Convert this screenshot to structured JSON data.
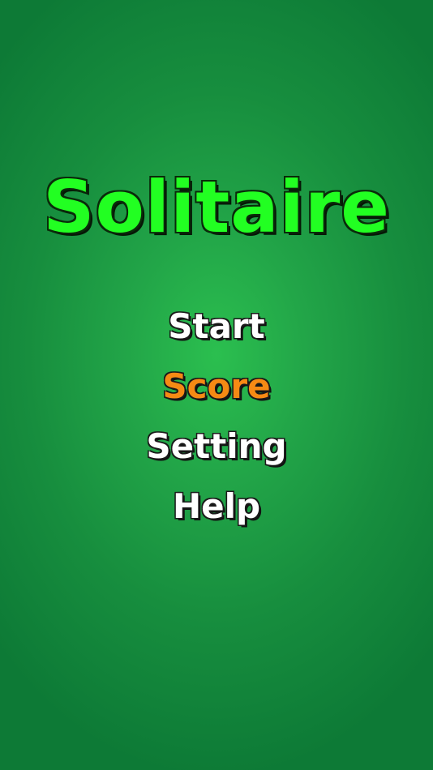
{
  "app": {
    "title": "Solitaire"
  },
  "menu": {
    "items": [
      {
        "label": "Start",
        "highlighted": false
      },
      {
        "label": "Score",
        "highlighted": true
      },
      {
        "label": "Setting",
        "highlighted": false
      },
      {
        "label": "Help",
        "highlighted": false
      }
    ]
  },
  "colors": {
    "background": "#22a548",
    "title": "#22ff22",
    "menu_text": "#ffffff",
    "menu_highlight": "#f68a14"
  }
}
